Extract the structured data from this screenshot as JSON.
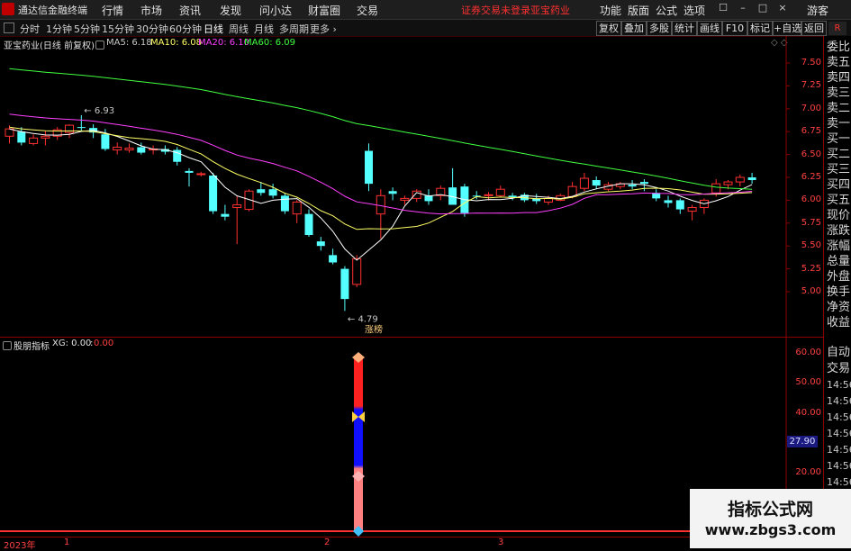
{
  "app": {
    "title": "通达信金融终端",
    "menus": [
      "行情",
      "市场",
      "资讯",
      "发现",
      "问小达",
      "财富圈",
      "交易"
    ],
    "notice": "证券交易未登录",
    "stock_tag": "亚宝药业",
    "right_menus": [
      "功能",
      "版面",
      "公式",
      "选项"
    ],
    "user": "游客"
  },
  "period_bar": {
    "periods": [
      "分时",
      "1分钟",
      "5分钟",
      "15分钟",
      "30分钟",
      "60分钟",
      "日线",
      "周线",
      "月线",
      "多周期",
      "更多"
    ],
    "active": "日线",
    "tools": [
      "复权",
      "叠加",
      "多股",
      "统计",
      "画线",
      "F10",
      "标记",
      "+自选",
      "返回"
    ]
  },
  "main_panel": {
    "header": "亚宝药业(日线 前复权)",
    "ma_labels": [
      {
        "text": "MA5: 6.18",
        "color": "#ffffff"
      },
      {
        "text": "MA10: 6.08",
        "color": "#ffff66"
      },
      {
        "text": "MA20: 6.10",
        "color": "#ff40ff"
      },
      {
        "text": "MA60: 6.09",
        "color": "#40ff40"
      }
    ],
    "y_ticks": [
      "7.50",
      "7.25",
      "7.00",
      "6.75",
      "6.50",
      "6.25",
      "6.00",
      "5.75",
      "5.50",
      "5.25",
      "5.00"
    ],
    "high_label": "6.93",
    "low_label": "4.79",
    "limit_tag": "涨榜"
  },
  "indicator_panel": {
    "header": "股朋指标",
    "xg_label": "XG: 0.00",
    "xg_value": "0.00",
    "y_ticks": [
      "60.00",
      "50.00",
      "40.00",
      "30.00",
      "20.00"
    ],
    "current_value": "27.90"
  },
  "x_axis": {
    "labels": [
      "2023年",
      "1",
      "2",
      "3"
    ]
  },
  "right_col": {
    "items": [
      "委比",
      "卖五",
      "卖四",
      "卖三",
      "卖二",
      "卖一",
      "买一",
      "买二",
      "买三",
      "买四",
      "买五",
      "现价",
      "涨跌",
      "涨幅",
      "总量",
      "外盘",
      "换手",
      "净资",
      "收益"
    ],
    "lower_items": [
      "自动",
      "交易",
      "14:56",
      "14:56",
      "14:56",
      "14:56",
      "14:56",
      "14:56",
      "14:56",
      "14:56"
    ],
    "top_tag": "R"
  },
  "chart_data": {
    "type": "candlestick",
    "title": "亚宝药业(日线 前复权)",
    "ylim": [
      4.7,
      7.75
    ],
    "candles": [
      [
        6.7,
        6.82,
        6.62,
        6.78
      ],
      [
        6.75,
        6.8,
        6.6,
        6.63
      ],
      [
        6.62,
        6.72,
        6.6,
        6.68
      ],
      [
        6.68,
        6.76,
        6.6,
        6.7
      ],
      [
        6.7,
        6.8,
        6.66,
        6.77
      ],
      [
        6.74,
        6.83,
        6.68,
        6.82
      ],
      [
        6.8,
        6.93,
        6.75,
        6.79
      ],
      [
        6.79,
        6.83,
        6.68,
        6.74
      ],
      [
        6.72,
        6.78,
        6.54,
        6.56
      ],
      [
        6.55,
        6.63,
        6.5,
        6.58
      ],
      [
        6.55,
        6.62,
        6.52,
        6.57
      ],
      [
        6.58,
        6.63,
        6.5,
        6.52
      ],
      [
        6.55,
        6.6,
        6.5,
        6.56
      ],
      [
        6.56,
        6.6,
        6.5,
        6.53
      ],
      [
        6.55,
        6.58,
        6.38,
        6.42
      ],
      [
        6.32,
        6.35,
        6.15,
        6.3
      ],
      [
        6.28,
        6.31,
        6.26,
        6.29
      ],
      [
        6.27,
        6.3,
        5.85,
        5.88
      ],
      [
        5.85,
        5.95,
        5.78,
        5.82
      ],
      [
        5.92,
        6.05,
        5.52,
        5.95
      ],
      [
        5.9,
        6.12,
        5.88,
        6.1
      ],
      [
        6.12,
        6.2,
        6.05,
        6.08
      ],
      [
        6.12,
        6.18,
        6.02,
        6.05
      ],
      [
        6.05,
        6.08,
        5.85,
        5.88
      ],
      [
        5.85,
        6.0,
        5.75,
        5.98
      ],
      [
        5.85,
        5.9,
        5.6,
        5.62
      ],
      [
        5.55,
        5.6,
        5.45,
        5.5
      ],
      [
        5.4,
        5.47,
        5.3,
        5.32
      ],
      [
        5.25,
        5.28,
        4.79,
        4.92
      ],
      [
        5.08,
        5.4,
        5.05,
        5.36
      ],
      [
        6.54,
        6.62,
        6.1,
        6.18
      ],
      [
        5.85,
        6.12,
        5.58,
        6.05
      ],
      [
        6.1,
        6.14,
        6.0,
        6.07
      ],
      [
        6.0,
        6.05,
        5.95,
        6.02
      ],
      [
        6.02,
        6.12,
        5.98,
        6.1
      ],
      [
        6.05,
        6.12,
        5.95,
        5.99
      ],
      [
        6.05,
        6.16,
        6.0,
        6.13
      ],
      [
        6.14,
        6.35,
        6.05,
        5.95
      ],
      [
        6.15,
        6.18,
        5.82,
        5.86
      ],
      [
        6.05,
        6.1,
        6.01,
        6.04
      ],
      [
        6.05,
        6.09,
        6.0,
        6.06
      ],
      [
        6.05,
        6.16,
        6.03,
        6.12
      ],
      [
        6.05,
        6.08,
        6.0,
        6.03
      ],
      [
        6.06,
        6.08,
        5.98,
        6.0
      ],
      [
        6.02,
        6.07,
        5.96,
        5.99
      ],
      [
        5.98,
        6.05,
        5.95,
        6.02
      ],
      [
        6.0,
        6.07,
        5.99,
        6.05
      ],
      [
        6.04,
        6.2,
        6.02,
        6.15
      ],
      [
        6.13,
        6.3,
        6.1,
        6.24
      ],
      [
        6.22,
        6.26,
        6.12,
        6.16
      ],
      [
        6.12,
        6.2,
        6.1,
        6.17
      ],
      [
        6.15,
        6.2,
        6.12,
        6.18
      ],
      [
        6.17,
        6.22,
        6.12,
        6.15
      ],
      [
        6.2,
        6.23,
        6.1,
        6.18
      ],
      [
        6.08,
        6.12,
        5.99,
        6.02
      ],
      [
        6.0,
        6.05,
        5.92,
        5.97
      ],
      [
        6.0,
        6.02,
        5.85,
        5.9
      ],
      [
        5.88,
        5.95,
        5.78,
        5.92
      ],
      [
        5.92,
        6.02,
        5.85,
        6.0
      ],
      [
        6.08,
        6.23,
        6.04,
        6.18
      ],
      [
        6.17,
        6.22,
        6.12,
        6.2
      ],
      [
        6.2,
        6.28,
        6.15,
        6.25
      ],
      [
        6.25,
        6.3,
        6.18,
        6.22
      ]
    ]
  }
}
